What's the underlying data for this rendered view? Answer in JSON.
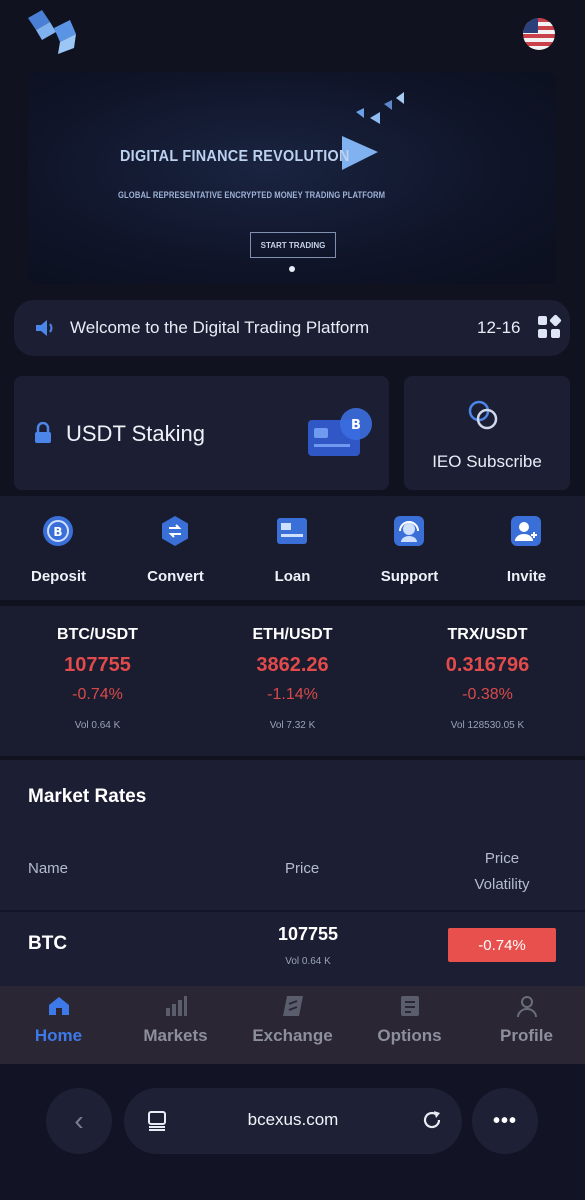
{
  "colors": {
    "background": "#10121f",
    "card": "#1c1f33",
    "accent": "#3d7ae8",
    "down": "#e24b4b",
    "badge_down": "#e8504e"
  },
  "header": {
    "logo_icon": "cube-logo-icon",
    "language_icon": "us-flag-icon"
  },
  "banner": {
    "title": "DIGITAL FINANCE REVOLUTION",
    "subtitle": "GLOBAL REPRESENTATIVE ENCRYPTED MONEY TRADING PLATFORM",
    "button": "START TRADING"
  },
  "notice": {
    "text": "Welcome to the Digital Trading Platform",
    "date": "12-16",
    "icon": "speaker-icon",
    "menu_icon": "grid-icon"
  },
  "cards": {
    "staking": {
      "label": "USDT Staking",
      "icon": "lock-icon"
    },
    "ieo": {
      "label": "IEO Subscribe",
      "icon": "circles-icon"
    }
  },
  "actions": [
    {
      "label": "Deposit",
      "icon": "bitcoin-coin-icon"
    },
    {
      "label": "Convert",
      "icon": "convert-icon"
    },
    {
      "label": "Loan",
      "icon": "card-icon"
    },
    {
      "label": "Support",
      "icon": "headset-icon"
    },
    {
      "label": "Invite",
      "icon": "user-plus-icon"
    }
  ],
  "tickers": [
    {
      "pair": "BTC/USDT",
      "price": "107755",
      "change": "-0.74%",
      "volume": "Vol 0.64 K"
    },
    {
      "pair": "ETH/USDT",
      "price": "3862.26",
      "change": "-1.14%",
      "volume": "Vol 7.32 K"
    },
    {
      "pair": "TRX/USDT",
      "price": "0.316796",
      "change": "-0.38%",
      "volume": "Vol 128530.05 K"
    }
  ],
  "market": {
    "title": "Market Rates",
    "headers": {
      "name": "Name",
      "price": "Price",
      "volatility_line1": "Price",
      "volatility_line2": "Volatility"
    },
    "rows": [
      {
        "name": "BTC",
        "price": "107755",
        "volume": "Vol 0.64 K",
        "change": "-0.74%"
      }
    ]
  },
  "tabbar": [
    {
      "label": "Home",
      "icon": "home-icon",
      "active": true
    },
    {
      "label": "Markets",
      "icon": "bar-chart-icon",
      "active": false
    },
    {
      "label": "Exchange",
      "icon": "exchange-icon",
      "active": false
    },
    {
      "label": "Options",
      "icon": "document-icon",
      "active": false
    },
    {
      "label": "Profile",
      "icon": "person-icon",
      "active": false
    }
  ],
  "browser": {
    "url": "bcexus.com",
    "back": "‹",
    "more": "•••"
  }
}
